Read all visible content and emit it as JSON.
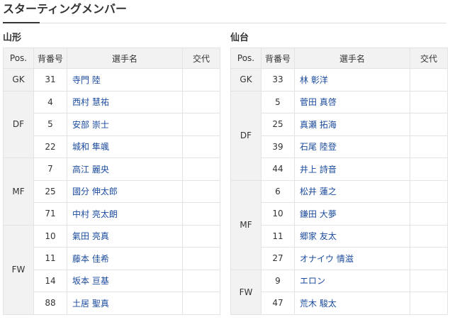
{
  "header": {
    "title": "スターティングメンバー"
  },
  "columns": {
    "pos": "Pos.",
    "num": "背番号",
    "name": "選手名",
    "sub": "交代"
  },
  "teams": [
    {
      "name": "山形",
      "groups": [
        {
          "pos": "GK",
          "players": [
            {
              "num": "31",
              "name": "寺門 陸"
            }
          ]
        },
        {
          "pos": "DF",
          "players": [
            {
              "num": "4",
              "name": "西村 慧祐"
            },
            {
              "num": "5",
              "name": "安部 崇士"
            },
            {
              "num": "22",
              "name": "城和 隼颯"
            }
          ]
        },
        {
          "pos": "MF",
          "players": [
            {
              "num": "7",
              "name": "高江 麗央"
            },
            {
              "num": "25",
              "name": "國分 伸太郎"
            },
            {
              "num": "71",
              "name": "中村 亮太朗"
            }
          ]
        },
        {
          "pos": "FW",
          "players": [
            {
              "num": "10",
              "name": "氣田 亮真"
            },
            {
              "num": "11",
              "name": "藤本 佳希"
            },
            {
              "num": "14",
              "name": "坂本 亘基"
            },
            {
              "num": "88",
              "name": "土居 聖真"
            }
          ]
        }
      ]
    },
    {
      "name": "仙台",
      "groups": [
        {
          "pos": "GK",
          "players": [
            {
              "num": "33",
              "name": "林 彰洋"
            }
          ]
        },
        {
          "pos": "DF",
          "players": [
            {
              "num": "5",
              "name": "菅田 真啓"
            },
            {
              "num": "25",
              "name": "真瀬 拓海"
            },
            {
              "num": "39",
              "name": "石尾 陸登"
            },
            {
              "num": "44",
              "name": "井上 詩音"
            }
          ]
        },
        {
          "pos": "MF",
          "players": [
            {
              "num": "6",
              "name": "松井 蓮之"
            },
            {
              "num": "10",
              "name": "鎌田 大夢"
            },
            {
              "num": "11",
              "name": "郷家 友太"
            },
            {
              "num": "27",
              "name": "オナイウ 情滋"
            }
          ]
        },
        {
          "pos": "FW",
          "players": [
            {
              "num": "9",
              "name": "エロン"
            },
            {
              "num": "47",
              "name": "荒木 駿太"
            }
          ]
        }
      ]
    }
  ]
}
